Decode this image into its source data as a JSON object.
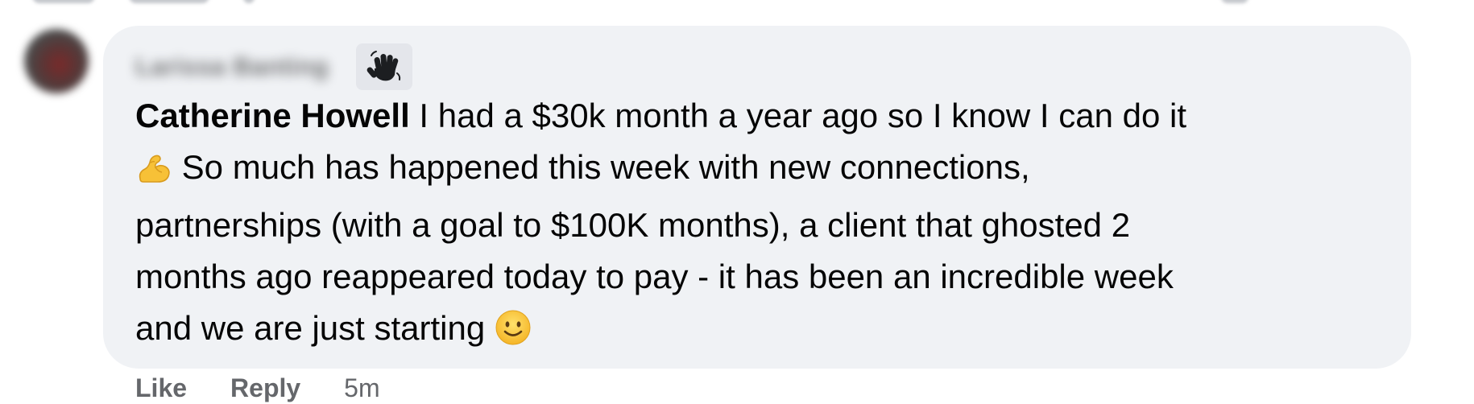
{
  "comment": {
    "author_name": "Larissa Banting",
    "author_badge_icon": "waving-hand-icon",
    "mention": "Catherine Howell",
    "text_line1": " I had a $30k month a year ago so I know I can do it",
    "text_line2_icon": "flexed-biceps-emoji",
    "text_line2": " So much has happened this week with new connections,",
    "text_line3": "partnerships (with a goal to $100K months), a client that ghosted 2",
    "text_line4": "months ago reappeared today to pay - it has been an incredible week",
    "text_line5": "and we are just starting",
    "text_end_icon": "smiling-face-emoji"
  },
  "actions": {
    "like_label": "Like",
    "reply_label": "Reply",
    "timestamp": "5m"
  },
  "colors": {
    "bubble_bg": "#f0f2f5",
    "text": "#050505",
    "secondary_text": "#65676b",
    "badge_bg": "#e4e6eb"
  }
}
